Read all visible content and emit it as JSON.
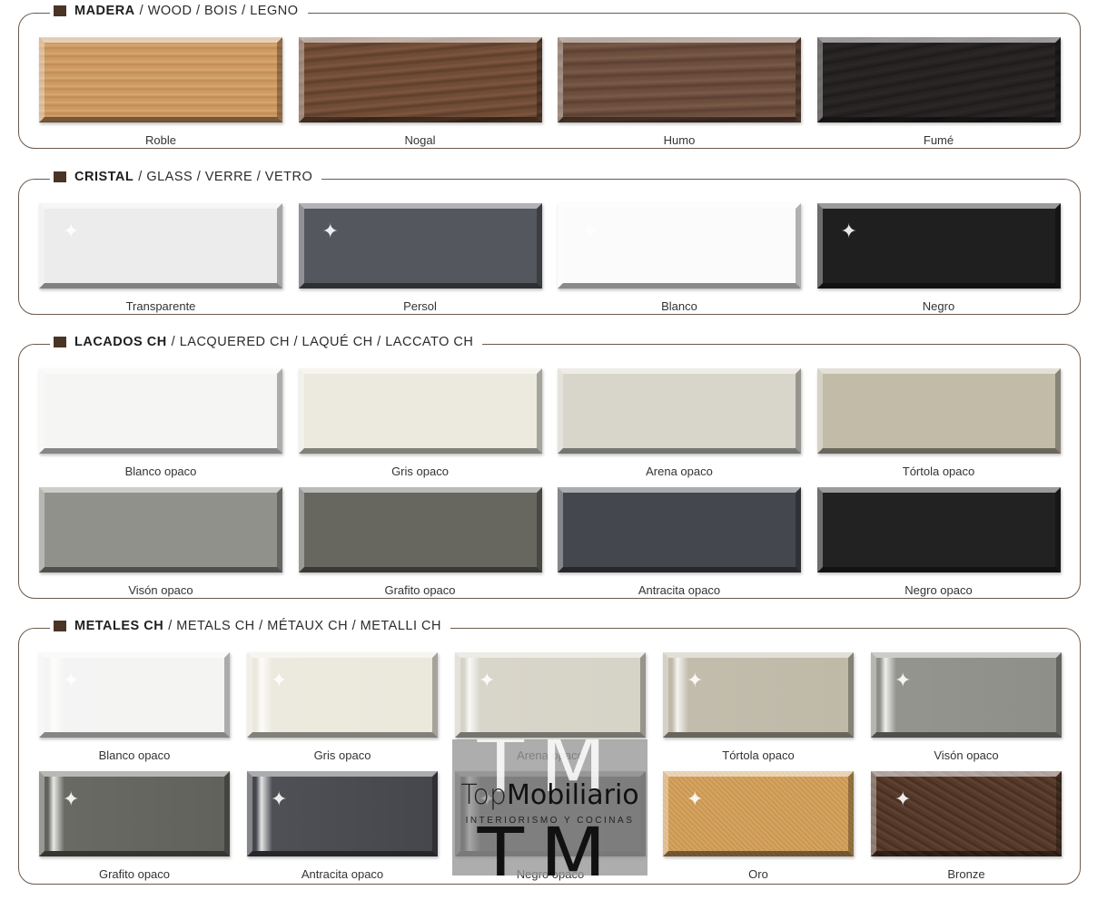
{
  "sections": [
    {
      "bold": "MADERA",
      "rest": "/ WOOD / BOIS / LEGNO",
      "swatches": [
        {
          "label": "Roble",
          "color": "#c9965f",
          "texture": "tex-wood-light"
        },
        {
          "label": "Nogal",
          "color": "#6e4a33",
          "texture": "tex-wood-brown"
        },
        {
          "label": "Humo",
          "color": "#6a4c3c",
          "texture": "tex-wood-smoke"
        },
        {
          "label": "Fumé",
          "color": "#232020",
          "texture": "tex-wood-fume"
        }
      ]
    },
    {
      "bold": "CRISTAL",
      "rest": "/ GLASS / VERRE / VETRO",
      "swatches": [
        {
          "label": "Transparente",
          "color": "#ececec",
          "sparkle": true
        },
        {
          "label": "Persol",
          "color": "#54575e",
          "sparkle": true
        },
        {
          "label": "Blanco",
          "color": "#fbfbfb",
          "sparkle": true
        },
        {
          "label": "Negro",
          "color": "#1f1f1f",
          "sparkle": true
        }
      ]
    },
    {
      "bold": "LACADOS CH",
      "rest": "/ LACQUERED CH / LAQUÉ CH / LACCATO CH",
      "swatches": [
        {
          "label": "Blanco opaco",
          "color": "#f5f5f4"
        },
        {
          "label": "Gris opaco",
          "color": "#eceadf"
        },
        {
          "label": "Arena opaco",
          "color": "#d8d5ca"
        },
        {
          "label": "Tórtola opaco",
          "color": "#c2bba8"
        },
        {
          "label": "Visón opaco",
          "color": "#90918a"
        },
        {
          "label": "Grafito opaco",
          "color": "#676760"
        },
        {
          "label": "Antracita opaco",
          "color": "#45474e"
        },
        {
          "label": "Negro opaco",
          "color": "#222222"
        }
      ]
    },
    {
      "bold": "METALES CH",
      "rest": "/ METALS CH / MÉTAUX CH / METALLI CH",
      "swatches": [
        {
          "label": "Blanco opaco",
          "color": "#f4f4f3",
          "sparkle": true,
          "metal": true
        },
        {
          "label": "Gris opaco",
          "color": "#ebe9dc",
          "sparkle": true,
          "metal": true
        },
        {
          "label": "Arena opaco",
          "color": "#d6d3c7",
          "sparkle": true,
          "metal": true
        },
        {
          "label": "Tórtola opaco",
          "color": "#bfb9a8",
          "sparkle": true,
          "metal": true
        },
        {
          "label": "Visón opaco",
          "color": "#8e8f88",
          "sparkle": true,
          "metal": true
        },
        {
          "label": "Grafito opaco",
          "color": "#62625c",
          "sparkle": true,
          "metal": true
        },
        {
          "label": "Antracita opaco",
          "color": "#45474d",
          "sparkle": true,
          "metal": true
        },
        {
          "label": "Negro opaco",
          "color": "#262626",
          "sparkle": true,
          "metal": true
        },
        {
          "label": "Oro",
          "color": "#cc9a55",
          "sparkle": true,
          "texture": "tex-gold"
        },
        {
          "label": "Bronze",
          "color": "#553a2a",
          "sparkle": true,
          "texture": "tex-bronze"
        }
      ]
    }
  ],
  "watermark": {
    "big": "TM",
    "name_light": "Top",
    "name_strong": "Mobiliario",
    "subtitle": "INTERIORISMO Y COCINAS"
  }
}
